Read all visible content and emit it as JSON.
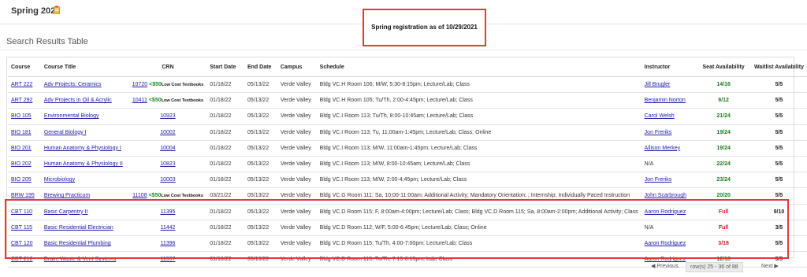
{
  "header": {
    "term": "Spring 2022",
    "notice": "Spring registration as of 10/29/2021"
  },
  "section_title": "Search Results Table",
  "columns": [
    "Course",
    "Course Title",
    "CRN",
    "Start Date",
    "End Date",
    "Campus",
    "Schedule",
    "Instructor",
    "Seat Availability",
    "Waitlist Availability"
  ],
  "lct": {
    "price": "<$50",
    "text": "Low Cost Textbooks"
  },
  "rows": [
    {
      "course": "ART 222",
      "title": "Adv Projects: Ceramics",
      "crn": "10720",
      "lct": true,
      "start": "01/18/22",
      "end": "05/13/22",
      "campus": "Verde Valley",
      "schedule": "Bldg VC.H Room 106; M/W, 5:30-8:15pm; Lecture/Lab; Class",
      "instructor": "Jill Brugler",
      "instructor_link": true,
      "seat": "14/16",
      "seat_color": "green",
      "waitlist": "5/5"
    },
    {
      "course": "ART 292",
      "title": "Adv Projects in Oil & Acrylic",
      "crn": "10411",
      "lct": true,
      "start": "01/18/22",
      "end": "05/13/22",
      "campus": "Verde Valley",
      "schedule": "Bldg VC.H Room 105; Tu/Th, 2:00-4:45pm; Lecture/Lab; Class",
      "instructor": "Benjamin Norton",
      "instructor_link": true,
      "seat": "9/12",
      "seat_color": "green",
      "waitlist": "5/5"
    },
    {
      "course": "BIO 105",
      "title": "Environmental Biology",
      "crn": "10923",
      "lct": false,
      "start": "01/18/22",
      "end": "05/13/22",
      "campus": "Verde Valley",
      "schedule": "Bldg VC.I Room 113; Tu/Th, 8:00-10:45am; Lecture/Lab; Class",
      "instructor": "Carol Welsh",
      "instructor_link": true,
      "seat": "21/24",
      "seat_color": "green",
      "waitlist": "5/5"
    },
    {
      "course": "BIO 181",
      "title": "General Biology I",
      "crn": "10002",
      "lct": false,
      "start": "01/18/22",
      "end": "05/13/22",
      "campus": "Verde Valley",
      "schedule": "Bldg VC.I Room 113; Tu, 11:00am-1:45pm; Lecture/Lab; Class; Online",
      "instructor": "Jon Freriks",
      "instructor_link": true,
      "seat": "19/24",
      "seat_color": "green",
      "waitlist": "5/5"
    },
    {
      "course": "BIO 201",
      "title": "Human Anatomy & Physiology I",
      "crn": "10004",
      "lct": false,
      "start": "01/18/22",
      "end": "05/13/22",
      "campus": "Verde Valley",
      "schedule": "Bldg VC.I Room 113; M/W, 11:00am-1:45pm; Lecture/Lab; Class",
      "instructor": "Allison Merkey",
      "instructor_link": true,
      "seat": "19/24",
      "seat_color": "green",
      "waitlist": "5/5"
    },
    {
      "course": "BIO 202",
      "title": "Human Anatomy & Physiology II",
      "crn": "10823",
      "lct": false,
      "start": "01/18/22",
      "end": "05/13/22",
      "campus": "Verde Valley",
      "schedule": "Bldg VC.I Room 113; M/W, 8:00-10:45am; Lecture/Lab; Class",
      "instructor": "N/A",
      "instructor_link": false,
      "seat": "22/24",
      "seat_color": "green",
      "waitlist": "5/5"
    },
    {
      "course": "BIO 205",
      "title": "Microbiology",
      "crn": "10003",
      "lct": false,
      "start": "01/18/22",
      "end": "05/13/22",
      "campus": "Verde Valley",
      "schedule": "Bldg VC.I Room 113; M/W, 2:00-4:45pm; Lecture/Lab; Class",
      "instructor": "Jon Freriks",
      "instructor_link": true,
      "seat": "23/24",
      "seat_color": "green",
      "waitlist": "5/5"
    },
    {
      "course": "BRW 195",
      "title": "Brewing Practicum",
      "crn": "11108",
      "lct": true,
      "start": "03/21/22",
      "end": "05/13/22",
      "campus": "Verde Valley",
      "schedule": "Bldg VC.G Room 111; Sa, 10:00-11:00am; Additional Activity; Mandatory Orientation; ; Internship; Individually Paced Instruction",
      "instructor": "John Scarbrough",
      "instructor_link": true,
      "seat": "20/20",
      "seat_color": "green",
      "waitlist": "5/5"
    },
    {
      "course": "CBT 110",
      "title": "Basic Carpentry II",
      "crn": "11395",
      "lct": false,
      "start": "01/18/22",
      "end": "05/13/22",
      "campus": "Verde Valley",
      "schedule": "Bldg VC.D Room 115; F, 8:00am-4:00pm; Lecture/Lab; Class; Bldg VC.D Room 115; Sa, 8:00am-2:00pm; Additional Activity; Class",
      "instructor": "Aaron Rodriguez",
      "instructor_link": true,
      "seat": "Full",
      "seat_color": "red",
      "waitlist": "9/10"
    },
    {
      "course": "CBT 115",
      "title": "Basic Residential Electrician",
      "crn": "11442",
      "lct": false,
      "start": "01/18/22",
      "end": "05/13/22",
      "campus": "Verde Valley",
      "schedule": "Bldg VC.D Room 112; W/F, 5:00-6:45pm; Lecture/Lab; Class; Online",
      "instructor": "N/A",
      "instructor_link": false,
      "seat": "Full",
      "seat_color": "red",
      "waitlist": "3/5"
    },
    {
      "course": "CBT 120",
      "title": "Basic Residential Plumbing",
      "crn": "11396",
      "lct": false,
      "start": "01/18/22",
      "end": "05/13/22",
      "campus": "Verde Valley",
      "schedule": "Bldg VC.D Room 115; Tu/Th, 4:00-7:00pm; Lecture/Lab; Class",
      "instructor": "Aaron Rodriguez",
      "instructor_link": true,
      "seat": "3/18",
      "seat_color": "red",
      "waitlist": "5/5"
    },
    {
      "course": "CBT 212",
      "title": "Drain, Waste & Vent Systems",
      "crn": "11397",
      "lct": false,
      "start": "01/18/22",
      "end": "05/13/22",
      "campus": "Verde Valley",
      "schedule": "Bldg VC.D Room 115; Tu/Th, 7:15-8:15pm; Lab; Class",
      "instructor": "Aaron Rodriguez",
      "instructor_link": true,
      "seat": "12/18",
      "seat_color": "green",
      "waitlist": "5/5"
    }
  ],
  "pagination": {
    "previous": "Previous",
    "rows_info": "row(s) 25 - 36 of 88",
    "next": "Next"
  },
  "colors": {
    "link": "#1a1aa6",
    "seat_green": "#1b7d1b",
    "seat_red": "#d21a1a",
    "highlight": "#e23a3a"
  },
  "icons": {
    "term": "clipboard-icon",
    "previous": "triangle-left-icon",
    "next": "triangle-right-icon"
  }
}
